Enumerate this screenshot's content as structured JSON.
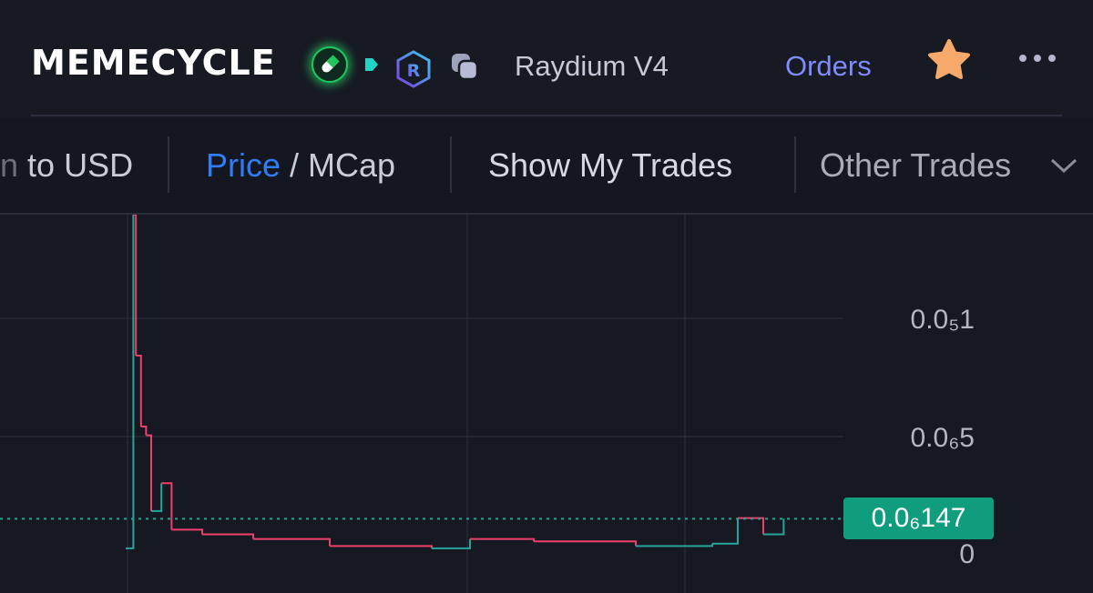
{
  "header": {
    "token_name": "MEMECYCLE",
    "dex_label": "Raydium V4",
    "orders_label": "Orders",
    "icons": [
      "pill-icon",
      "tag-icon",
      "raydium-icon",
      "copy-icon",
      "star-icon",
      "more-icon"
    ],
    "colors": {
      "accent": "#7f8cff",
      "pill": "#22c55e",
      "star": "#f6a96a"
    }
  },
  "toolbar": {
    "usd_prefix": "n",
    "usd_label": "to USD",
    "price_label": "Price",
    "price_sep": " / ",
    "mcap_label": "MCap",
    "show_trades_label": "Show My Trades",
    "other_trades_label": "Other Trades",
    "colors": {
      "active": "#2f7cf6"
    }
  },
  "chart_data": {
    "type": "candlestick",
    "y_ticks": [
      {
        "label": "0.0₅1",
        "value": 1e-05
      },
      {
        "label": "0.0₆5",
        "value": 5e-07
      },
      {
        "label": "0",
        "value": 0
      }
    ],
    "current_price_label": "0.0₆147",
    "current_price": 1.47e-07,
    "colors": {
      "up": "#26a69a",
      "down": "#ef3f6b",
      "current_price": "#0f9d7e"
    },
    "series": [
      {
        "x": 0,
        "value": 2e-08
      },
      {
        "x": 3,
        "value": 2e-05
      },
      {
        "x": 4,
        "value": 7e-06
      },
      {
        "x": 6,
        "value": 1.3e-06
      },
      {
        "x": 8,
        "value": 6e-07
      },
      {
        "x": 10,
        "value": 1.8e-07
      },
      {
        "x": 14,
        "value": 3e-07
      },
      {
        "x": 18,
        "value": 1e-07
      },
      {
        "x": 30,
        "value": 8e-08
      },
      {
        "x": 50,
        "value": 6e-08
      },
      {
        "x": 80,
        "value": 3e-08
      },
      {
        "x": 120,
        "value": 2e-08
      },
      {
        "x": 135,
        "value": 6e-08
      },
      {
        "x": 160,
        "value": 5e-08
      },
      {
        "x": 200,
        "value": 3e-08
      },
      {
        "x": 230,
        "value": 4e-08
      },
      {
        "x": 240,
        "value": 1.5e-07
      },
      {
        "x": 250,
        "value": 8e-08
      },
      {
        "x": 258,
        "value": 1.47e-07
      }
    ]
  }
}
